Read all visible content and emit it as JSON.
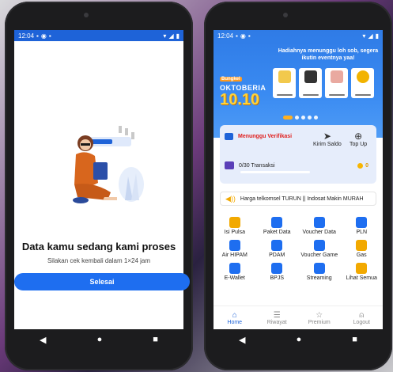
{
  "left_phone": {
    "status_time": "12:04",
    "title": "Data kamu sedang kami proses",
    "subtitle": "Silakan cek kembali dalam 1×24 jam",
    "button_label": "Selesai",
    "nav": {
      "back": "◀",
      "home": "●",
      "recent": "■"
    }
  },
  "right_phone": {
    "status_time": "12:04",
    "banner": {
      "headline": "Hadiahnya menunggu loh sob, segera ikutin eventnya yaa!",
      "event_tag": "Bungkel",
      "event_name": "OKTOBERIA",
      "event_date": "10.10",
      "active_slide": 1,
      "slide_count": 5
    },
    "wallet": {
      "verification_status": "Menunggu Verifikasi",
      "send_label": "Kirim Saldo",
      "topup_label": "Top Up",
      "transactions": "0/30 Transaksi",
      "coins": "0"
    },
    "promo_text": "Harga telkomsel TURUN || Indosat Makin MURAH",
    "services": [
      {
        "label": "Isi Pulsa",
        "icon": "phone-icon",
        "color": "#f2a900"
      },
      {
        "label": "Paket Data",
        "icon": "globe-icon",
        "color": "#1e6ef0"
      },
      {
        "label": "Voucher Data",
        "icon": "ticket-icon",
        "color": "#1e6ef0"
      },
      {
        "label": "PLN",
        "icon": "bolt-icon",
        "color": "#1e6ef0"
      },
      {
        "label": "Air HIPAM",
        "icon": "faucet-icon",
        "color": "#1e6ef0"
      },
      {
        "label": "PDAM",
        "icon": "drop-icon",
        "color": "#1e6ef0"
      },
      {
        "label": "Voucher Game",
        "icon": "gamepad-icon",
        "color": "#1e6ef0"
      },
      {
        "label": "Gas",
        "icon": "flame-icon",
        "color": "#f2a900"
      },
      {
        "label": "E-Wallet",
        "icon": "wallet-icon",
        "color": "#1e6ef0"
      },
      {
        "label": "BPJS",
        "icon": "shield-icon",
        "color": "#1e6ef0"
      },
      {
        "label": "Streaming",
        "icon": "tv-icon",
        "color": "#1e6ef0"
      },
      {
        "label": "Lihat Semua",
        "icon": "grid-icon",
        "color": "#f2a900"
      }
    ],
    "bottom_nav": [
      {
        "label": "Home",
        "icon": "home-icon",
        "glyph": "⌂"
      },
      {
        "label": "Riwayat",
        "icon": "history-icon",
        "glyph": "☰"
      },
      {
        "label": "Premium",
        "icon": "star-icon",
        "glyph": "☆"
      },
      {
        "label": "Logout",
        "icon": "user-icon",
        "glyph": "⍝"
      }
    ],
    "nav": {
      "back": "◀",
      "home": "●",
      "recent": "■"
    }
  }
}
